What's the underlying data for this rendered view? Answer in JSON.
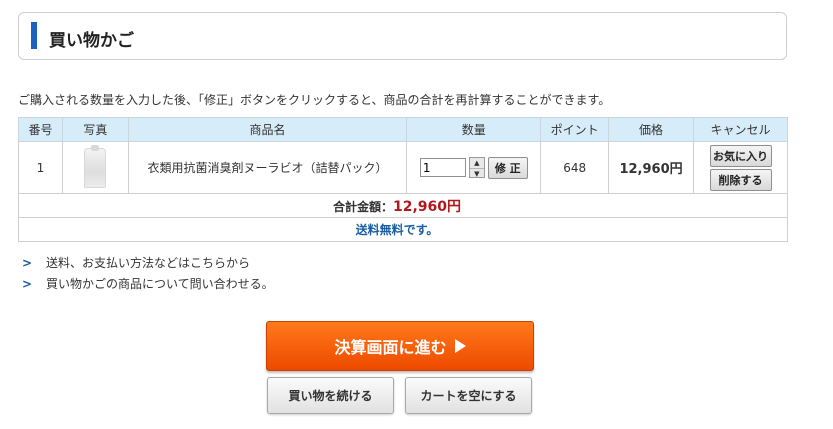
{
  "header": {
    "title": "買い物かご"
  },
  "intro_text": "ご購入される数量を入力した後、「修正」ボタンをクリックすると、商品の合計を再計算することができます。",
  "table": {
    "headers": [
      "番号",
      "写真",
      "商品名",
      "数量",
      "ポイント",
      "価格",
      "キャンセル"
    ],
    "rows": [
      {
        "number": "1",
        "product_name": "衣類用抗菌消臭剤ヌーラビオ（詰替パック）",
        "quantity": "1",
        "update_label": "修 正",
        "points": "648",
        "price": "12,960円",
        "favorite_label": "お気に入り",
        "delete_label": "削除する"
      }
    ],
    "total_label": "合計金額：",
    "total_value": "12,960円",
    "shipping_note": "送料無料です。"
  },
  "links": [
    {
      "label": "送料、お支払い方法などはこちらから"
    },
    {
      "label": "買い物かごの商品について問い合わせる。"
    }
  ],
  "buttons": {
    "checkout": "決算画面に進む",
    "continue_shopping": "買い物を続ける",
    "empty_cart": "カートを空にする"
  },
  "colors": {
    "accent_blue": "#1a63c3",
    "checkout_orange": "#f25a0b",
    "total_red": "#b4161e",
    "header_bg": "#d6ecf8"
  }
}
